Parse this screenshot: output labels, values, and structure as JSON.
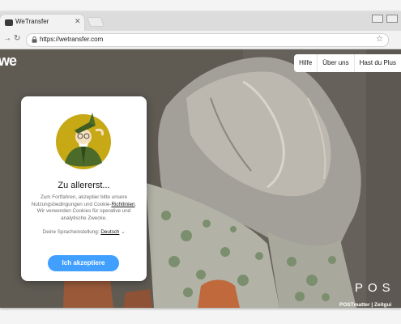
{
  "browser": {
    "tab_title": "WeTransfer",
    "url": "https://wetransfer.com"
  },
  "page": {
    "logo": "we",
    "nav": [
      {
        "label": "Hilfe"
      },
      {
        "label": "Über uns"
      },
      {
        "label": "Hast du Plus"
      }
    ],
    "brand_text": "POS",
    "credit": "POSTmatter | Zeitgui"
  },
  "consent": {
    "title": "Zu allererst...",
    "body_before_link": "Zum Fortfahren, akzeptier bitte unsere Nutzungsbedingungen und Cookie-",
    "body_link": "Richtlinien",
    "body_after_link": ". Wir verwenden Cookies für operative und analytische Zwecke.",
    "language_label": "Deine Spracheinstellung:",
    "language_value": "Deutsch",
    "accept_label": "Ich akzeptiere"
  },
  "colors": {
    "accent": "#409fff",
    "illustration_bg": "#c6a915"
  }
}
